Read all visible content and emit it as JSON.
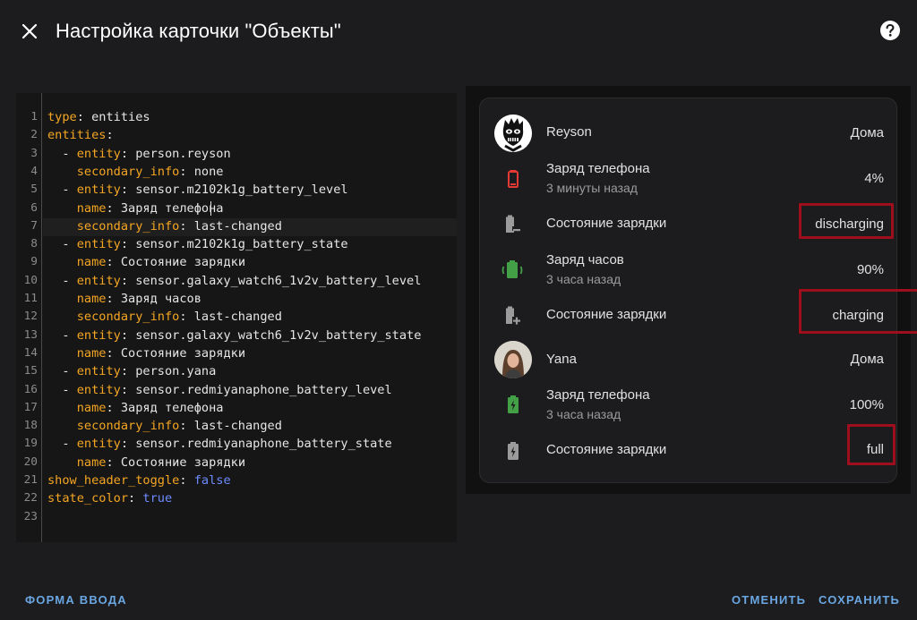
{
  "dialog": {
    "title": "Настройка карточки \"Объекты\""
  },
  "editor": {
    "lines": [
      {
        "n": "1"
      },
      {
        "n": "2"
      },
      {
        "n": "3"
      },
      {
        "n": "4"
      },
      {
        "n": "5"
      },
      {
        "n": "6"
      },
      {
        "n": "7"
      },
      {
        "n": "8"
      },
      {
        "n": "9"
      },
      {
        "n": "10"
      },
      {
        "n": "11"
      },
      {
        "n": "12"
      },
      {
        "n": "13"
      },
      {
        "n": "14"
      },
      {
        "n": "15"
      },
      {
        "n": "16"
      },
      {
        "n": "17"
      },
      {
        "n": "18"
      },
      {
        "n": "19"
      },
      {
        "n": "20"
      },
      {
        "n": "21"
      },
      {
        "n": "22"
      },
      {
        "n": "23"
      }
    ],
    "code": {
      "l1k": "type",
      "l1v": " entities",
      "l2k": "entities",
      "l3k": "entity",
      "l3v": " person.reyson",
      "l4k": "secondary_info",
      "l4v": " none",
      "l5k": "entity",
      "l5v": " sensor.m2102k1g_battery_level",
      "l6k": "name",
      "l6v": " Заряд телефона",
      "l7k": "secondary_info",
      "l7v": " last-changed",
      "l8k": "entity",
      "l8v": " sensor.m2102k1g_battery_state",
      "l9k": "name",
      "l9v": " Состояние зарядки",
      "l10k": "entity",
      "l10v": " sensor.galaxy_watch6_1v2v_battery_level",
      "l11k": "name",
      "l11v": " Заряд часов",
      "l12k": "secondary_info",
      "l12v": " last-changed",
      "l13k": "entity",
      "l13v": " sensor.galaxy_watch6_1v2v_battery_state",
      "l14k": "name",
      "l14v": " Состояние зарядки",
      "l15k": "entity",
      "l15v": " person.yana",
      "l16k": "entity",
      "l16v": " sensor.redmiyanaphone_battery_level",
      "l17k": "name",
      "l17v": " Заряд телефона",
      "l18k": "secondary_info",
      "l18v": " last-changed",
      "l19k": "entity",
      "l19v": " sensor.redmiyanaphone_battery_state",
      "l20k": "name",
      "l20v": " Состояние зарядки",
      "l21k": "show_header_toggle",
      "l21v": "false",
      "l22k": "state_color",
      "l22v": "true"
    }
  },
  "card": {
    "rows": [
      {
        "name": "Reyson",
        "secondary": "",
        "state": "Дома",
        "icon": "person-avatar-reyson"
      },
      {
        "name": "Заряд телефона",
        "secondary": "3 минуты назад",
        "state": "4%",
        "icon": "battery-low-icon",
        "color": "#e53935"
      },
      {
        "name": "Состояние зарядки",
        "secondary": "",
        "state": "discharging",
        "icon": "battery-minus-icon",
        "color": "#9b9b9b"
      },
      {
        "name": "Заряд часов",
        "secondary": "3 часа назад",
        "state": "90%",
        "icon": "battery-charging-wireless-icon",
        "color": "#43a047"
      },
      {
        "name": "Состояние зарядки",
        "secondary": "",
        "state": "charging",
        "icon": "battery-plus-icon",
        "color": "#9b9b9b"
      },
      {
        "name": "Yana",
        "secondary": "",
        "state": "Дома",
        "icon": "person-avatar-yana"
      },
      {
        "name": "Заряд телефона",
        "secondary": "3 часа назад",
        "state": "100%",
        "icon": "battery-charging-icon",
        "color": "#43a047"
      },
      {
        "name": "Состояние зарядки",
        "secondary": "",
        "state": "full",
        "icon": "battery-charging-icon",
        "color": "#9b9b9b"
      }
    ]
  },
  "footer": {
    "form_label": "ФОРМА ВВОДА",
    "cancel_label": "ОТМЕНИТЬ",
    "save_label": "СОХРАНИТЬ"
  },
  "colors": {
    "accent": "#6aa6e2",
    "highlight": "#9e0e1c",
    "yaml_key": "#f5a623",
    "yaml_bool": "#6e8bff"
  }
}
